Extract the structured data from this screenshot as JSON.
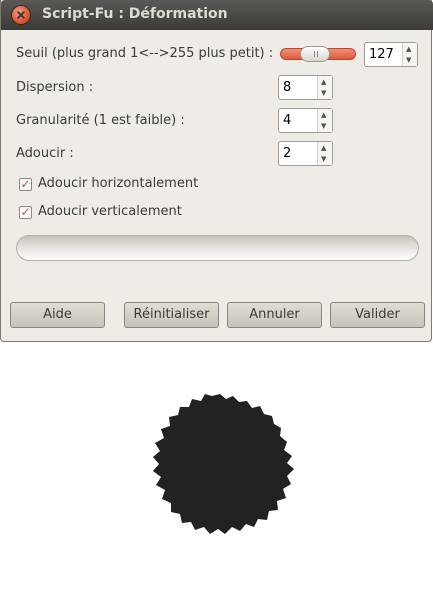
{
  "window": {
    "title": "Script-Fu : Déformation"
  },
  "fields": {
    "threshold": {
      "label": "Seuil (plus grand 1<-->255 plus petit) :",
      "value": "127",
      "slider_fraction": 0.5
    },
    "spread": {
      "label": "Dispersion :",
      "value": "8"
    },
    "granularity": {
      "label": "Granularité (1 est faible) :",
      "value": "4"
    },
    "smooth": {
      "label": "Adoucir :",
      "value": "2"
    }
  },
  "checkboxes": {
    "smooth_horizontal": {
      "label": "Adoucir horizontalement",
      "checked": true
    },
    "smooth_vertical": {
      "label": "Adoucir verticalement",
      "checked": true
    }
  },
  "icons": {
    "spin_up": "▲",
    "spin_down": "▼",
    "check": "✓"
  },
  "buttons": {
    "help": "Aide",
    "reset": "Réinitialiser",
    "cancel": "Annuler",
    "ok": "Valider"
  },
  "colors": {
    "titlebar": "#3c3b37",
    "accent": "#dd5630",
    "window_bg": "#efebe7",
    "blob": "#222222"
  }
}
